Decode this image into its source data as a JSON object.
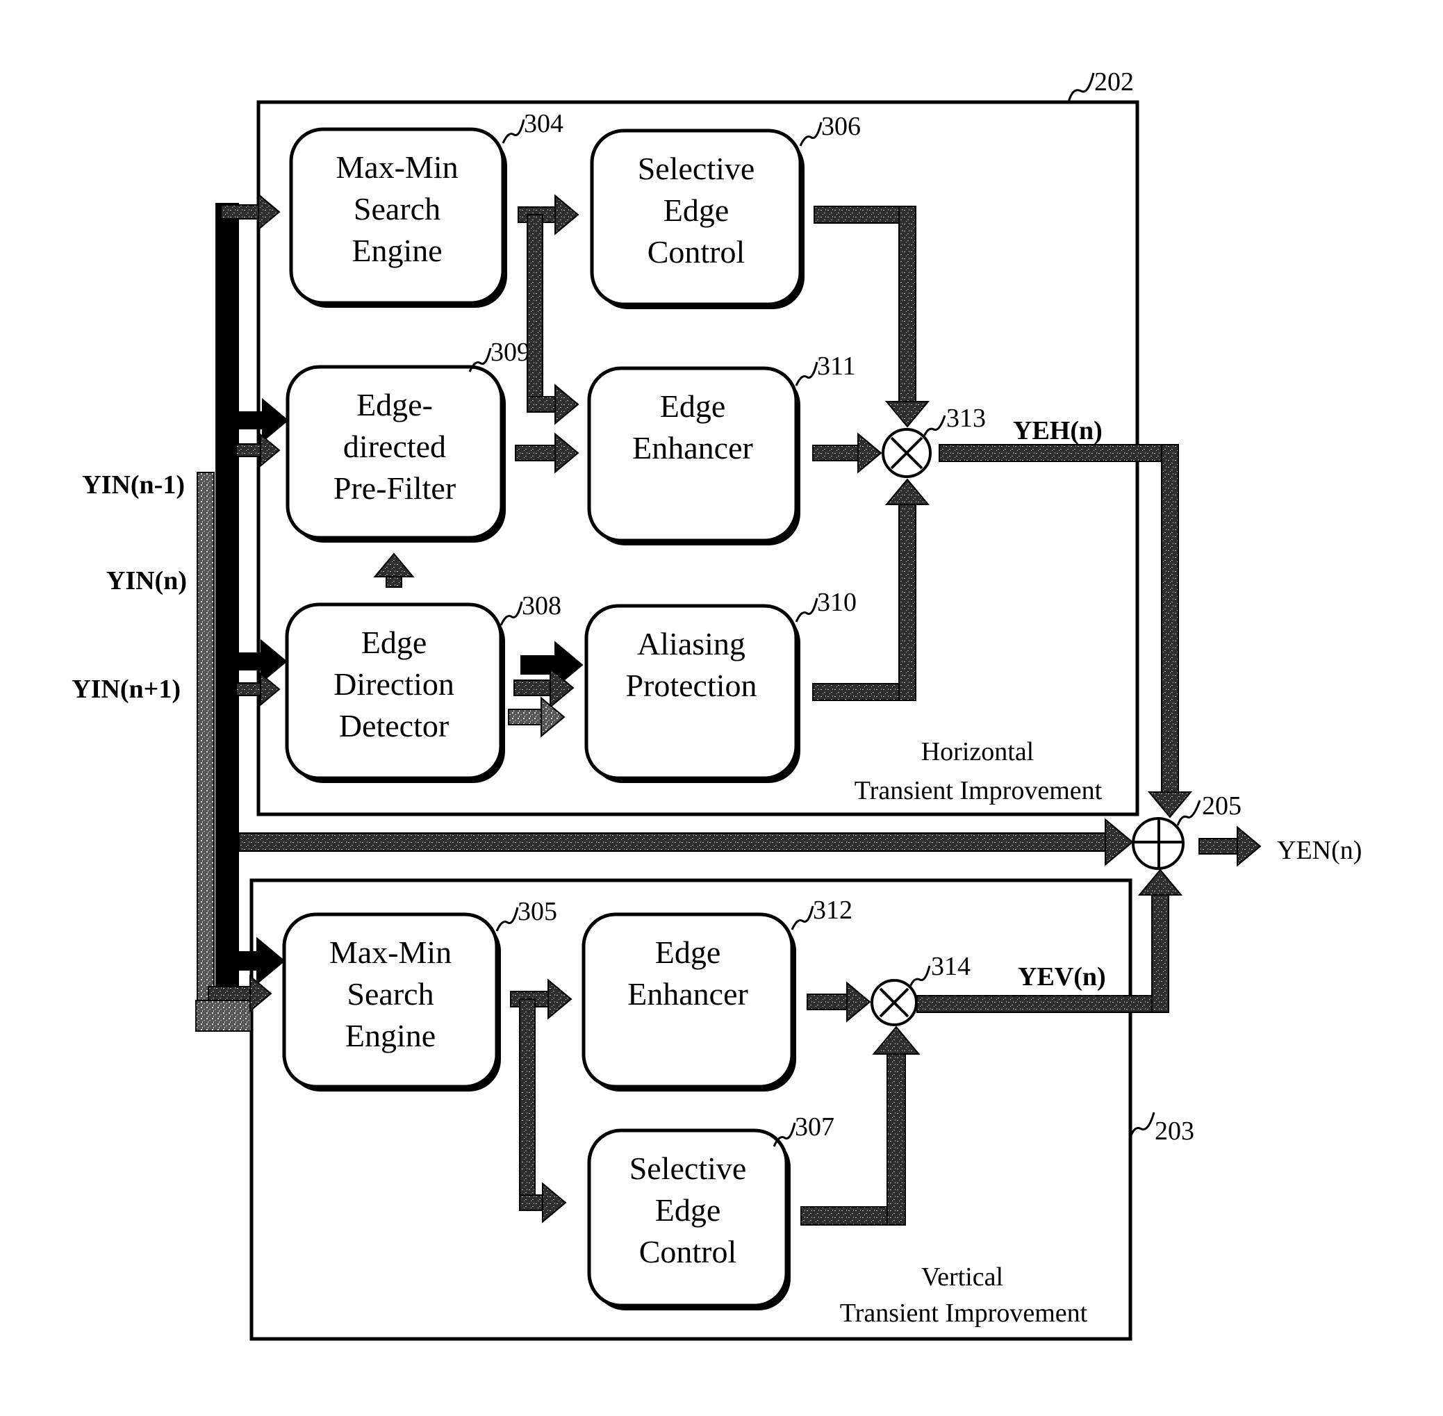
{
  "figure": {
    "inputs": {
      "prev": "YIN(n-1)",
      "curr": "YIN(n)",
      "next": "YIN(n+1)"
    },
    "horizontal_section": {
      "ref": "202",
      "title_line1": "Horizontal",
      "title_line2": "Transient Improvement",
      "blocks": {
        "max_min": {
          "ref": "304",
          "lines": [
            "Max-Min",
            "Search",
            "Engine"
          ]
        },
        "selective": {
          "ref": "306",
          "lines": [
            "Selective",
            "Edge",
            "Control"
          ]
        },
        "prefilter": {
          "ref": "309",
          "lines": [
            "Edge-",
            "directed",
            "Pre-Filter"
          ]
        },
        "enhancer": {
          "ref": "311",
          "lines": [
            "Edge",
            "Enhancer"
          ]
        },
        "direction": {
          "ref": "308",
          "lines": [
            "Edge",
            "Direction",
            "Detector"
          ]
        },
        "aliasing": {
          "ref": "310",
          "lines": [
            "Aliasing",
            "Protection"
          ]
        }
      },
      "multiplier": {
        "ref": "313",
        "symbol": "multiply"
      },
      "output_signal": "YEH(n)"
    },
    "vertical_section": {
      "ref": "203",
      "title_line1": "Vertical",
      "title_line2": "Transient Improvement",
      "blocks": {
        "max_min": {
          "ref": "305",
          "lines": [
            "Max-Min",
            "Search",
            "Engine"
          ]
        },
        "enhancer": {
          "ref": "312",
          "lines": [
            "Edge",
            "Enhancer"
          ]
        },
        "selective": {
          "ref": "307",
          "lines": [
            "Selective",
            "Edge",
            "Control"
          ]
        }
      },
      "multiplier": {
        "ref": "314",
        "symbol": "multiply"
      },
      "output_signal": "YEV(n)"
    },
    "adder": {
      "ref": "205",
      "symbol": "add"
    },
    "output": "YEN(n)",
    "colors": {
      "ink": "#000000",
      "grey_signal": "#4a4a4a",
      "light_signal": "#8a8a8a",
      "paper": "#ffffff"
    }
  }
}
